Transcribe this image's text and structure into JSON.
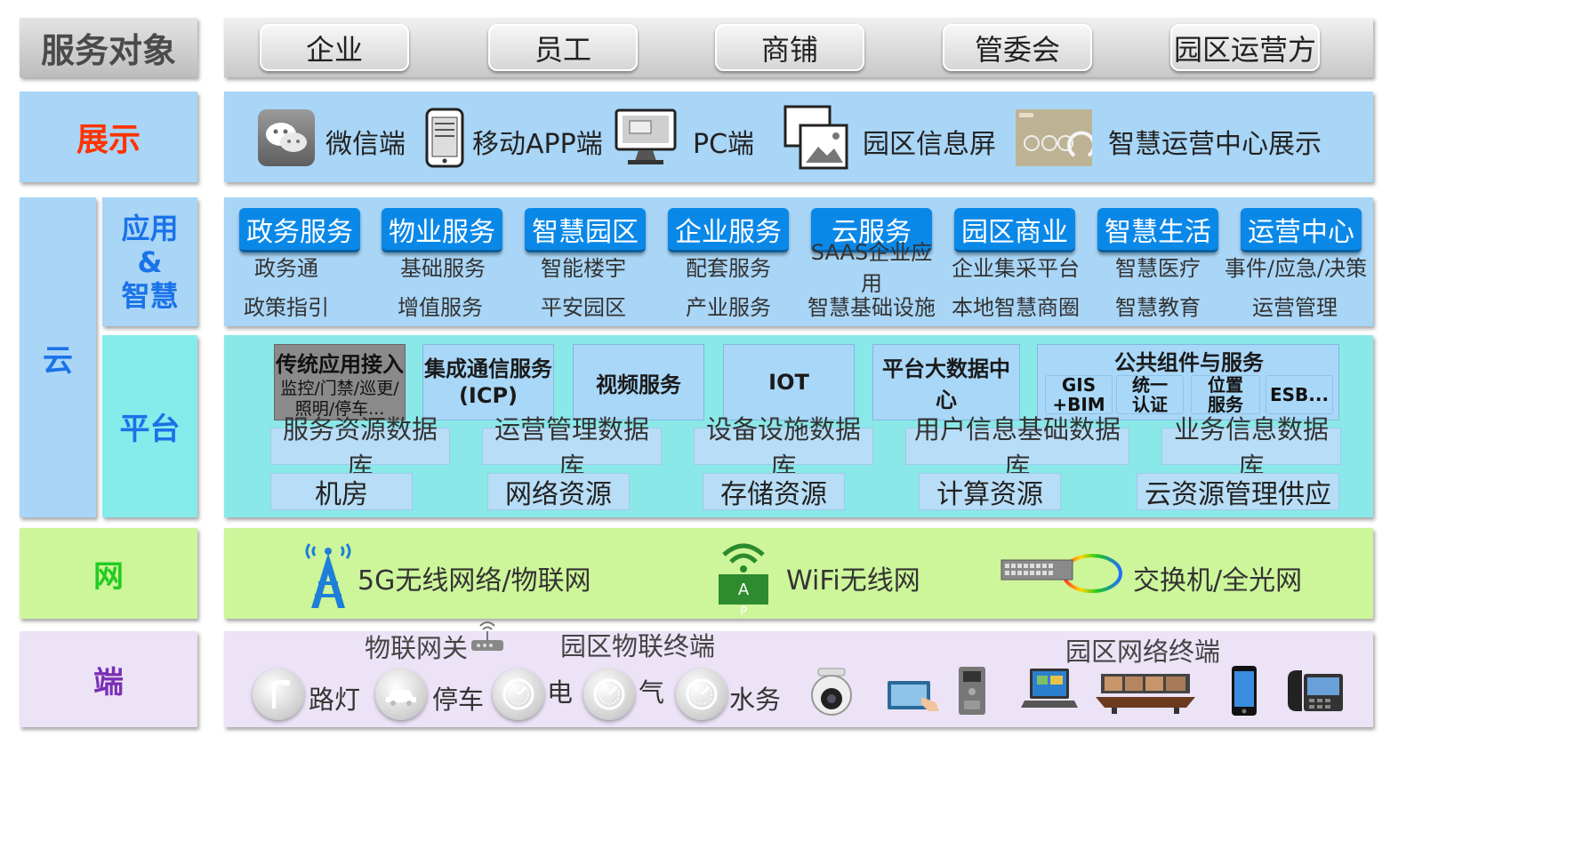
{
  "rows": {
    "service": "服务对象",
    "display": "展示",
    "cloud": "云",
    "app_lines": [
      "应用",
      "&",
      "智慧"
    ],
    "platform": "平台",
    "network": "网",
    "terminal": "端"
  },
  "service_targets": [
    "企业",
    "员工",
    "商铺",
    "管委会",
    "园区运营方"
  ],
  "display_items": [
    {
      "icon": "wechat-icon",
      "label": "微信端"
    },
    {
      "icon": "mobile-app-icon",
      "label": "移动APP端"
    },
    {
      "icon": "pc-monitor-icon",
      "label": "PC端"
    },
    {
      "icon": "info-screen-icon",
      "label": "园区信息屏"
    },
    {
      "icon": "operations-dashboard-icon",
      "label": "智慧运营中心展示"
    }
  ],
  "apps": [
    {
      "title": "政务服务",
      "items": [
        "政务通",
        "政策指引"
      ]
    },
    {
      "title": "物业服务",
      "items": [
        "基础服务",
        "增值服务"
      ]
    },
    {
      "title": "智慧园区",
      "items": [
        "智能楼宇",
        "平安园区"
      ]
    },
    {
      "title": "企业服务",
      "items": [
        "配套服务",
        "产业服务"
      ]
    },
    {
      "title": "云服务",
      "items": [
        "SAAS企业应用",
        "智慧基础设施"
      ]
    },
    {
      "title": "园区商业",
      "items": [
        "企业集采平台",
        "本地智慧商圈"
      ]
    },
    {
      "title": "智慧生活",
      "items": [
        "智慧医疗",
        "智慧教育"
      ]
    },
    {
      "title": "运营中心",
      "items": [
        "事件/应急/决策",
        "运营管理"
      ]
    }
  ],
  "platform": {
    "legacy": {
      "title": "传统应用接入",
      "lines": [
        "监控/门禁/巡更/",
        "照明/停车..."
      ]
    },
    "icp_lines": [
      "集成通信服务",
      "(ICP)"
    ],
    "video": "视频服务",
    "iot": "IOT",
    "bigdata": "平台大数据中心",
    "common": {
      "title": "公共组件与服务",
      "components": [
        [
          "GIS",
          "+BIM"
        ],
        [
          "统一",
          "认证"
        ],
        [
          "位置",
          "服务"
        ],
        [
          "ESB..."
        ]
      ]
    },
    "databases": [
      "服务资源数据库",
      "运营管理数据库",
      "设备设施数据库",
      "用户信息基础数据库",
      "业务信息数据库"
    ],
    "resources": [
      "机房",
      "网络资源",
      "存储资源",
      "计算资源",
      "云资源管理供应"
    ]
  },
  "network_items": [
    {
      "icon": "antenna-5g-icon",
      "label": "5G无线网络/物联网"
    },
    {
      "icon": "wifi-ap-icon",
      "label": "WiFi无线网",
      "badge": "A",
      "badge2": "P"
    },
    {
      "icon": "switch-fiber-icon",
      "label": "交换机/全光网"
    }
  ],
  "terminal": {
    "iot_gateway": "物联网关",
    "iot_terminals": "园区物联终端",
    "network_terminals": "园区网络终端",
    "items": [
      "路灯",
      "停车",
      "电",
      "气",
      "水务"
    ]
  },
  "colors": {
    "accent_blue": "#0a88e8",
    "display_title": "#ff3300",
    "app_title": "#1a73e8",
    "network_title": "#22cc22",
    "terminal_title": "#7a2fb5"
  }
}
